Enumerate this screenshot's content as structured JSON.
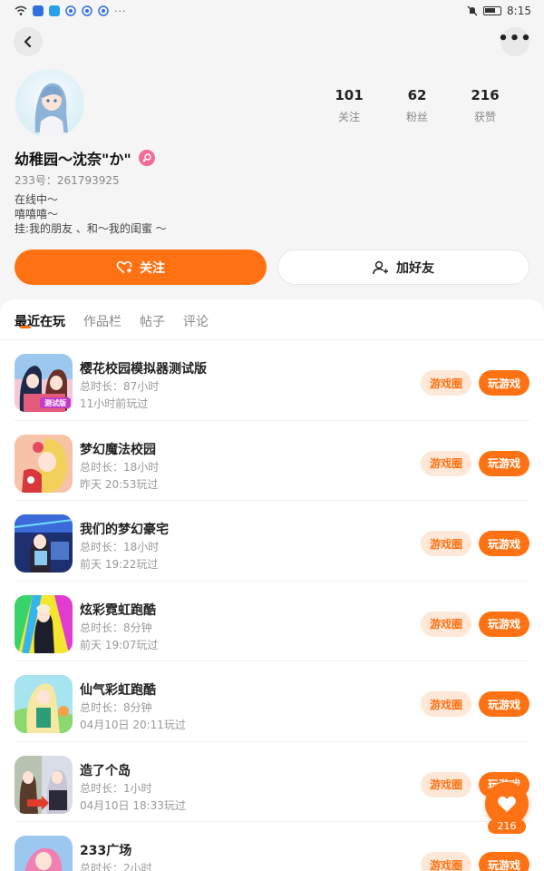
{
  "status_bar": {
    "time": "8:15",
    "dots": "···"
  },
  "header": {
    "back_icon": "chevron-left-icon",
    "more_icon": "more-horizontal-icon",
    "more_text": "•••"
  },
  "profile": {
    "name": "幼稚园～沈奈\"か\"",
    "id_text": "233号：261793925",
    "gender_icon": "female-icon",
    "bio_lines": [
      "在线中～",
      "嘻嘻嘻～",
      "挂:我的朋友 、和～我的闺蜜 ～"
    ],
    "stats": [
      {
        "value": "101",
        "label": "关注"
      },
      {
        "value": "62",
        "label": "粉丝"
      },
      {
        "value": "216",
        "label": "获赞"
      }
    ]
  },
  "actions": {
    "follow_label": "关注",
    "add_friend_label": "加好友"
  },
  "tabs": [
    {
      "label": "最近在玩",
      "active": true
    },
    {
      "label": "作品栏",
      "active": false
    },
    {
      "label": "帖子",
      "active": false
    },
    {
      "label": "评论",
      "active": false
    }
  ],
  "games": [
    {
      "title": "樱花校园模拟器测试版",
      "duration": "总时长：87小时",
      "last_played": "11小时前玩过",
      "icon_badge": "测试版",
      "circle_label": "游戏圈",
      "play_label": "玩游戏"
    },
    {
      "title": "梦幻魔法校园",
      "duration": "总时长：18小时",
      "last_played": "昨天 20:53玩过",
      "circle_label": "游戏圈",
      "play_label": "玩游戏"
    },
    {
      "title": "我们的梦幻豪宅",
      "duration": "总时长：18小时",
      "last_played": "前天 19:22玩过",
      "circle_label": "游戏圈",
      "play_label": "玩游戏"
    },
    {
      "title": "炫彩霓虹跑酷",
      "duration": "总时长：8分钟",
      "last_played": "前天 19:07玩过",
      "circle_label": "游戏圈",
      "play_label": "玩游戏"
    },
    {
      "title": "仙气彩虹跑酷",
      "duration": "总时长：8分钟",
      "last_played": "04月10日 20:11玩过",
      "circle_label": "游戏圈",
      "play_label": "玩游戏"
    },
    {
      "title": "造了个岛",
      "duration": "总时长：1小时",
      "last_played": "04月10日 18:33玩过",
      "circle_label": "游戏圈",
      "play_label": "玩游戏"
    },
    {
      "title": "233广场",
      "duration": "总时长：2小时",
      "last_played": "",
      "circle_label": "游戏圈",
      "play_label": "玩游戏"
    }
  ],
  "fab": {
    "icon": "heart-icon",
    "count": "216"
  },
  "colors": {
    "accent": "#ff7214",
    "accent_soft": "#fde8d8",
    "gender_pink": "#f36b96"
  }
}
